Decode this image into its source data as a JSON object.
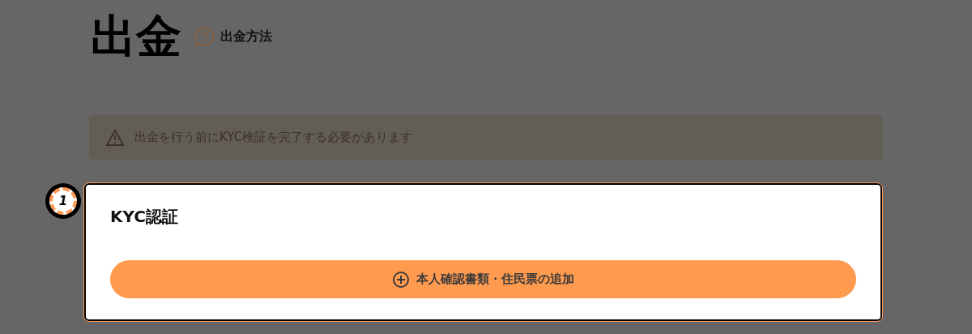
{
  "page_title": "出金",
  "help_link": {
    "label": "出金方法"
  },
  "alert": {
    "message": "出金を行う前にKYC検証を完了する必要があります"
  },
  "step": {
    "number": "1",
    "title": "KYC認証",
    "button": {
      "label": "本人確認書類・住民票の追加"
    }
  }
}
